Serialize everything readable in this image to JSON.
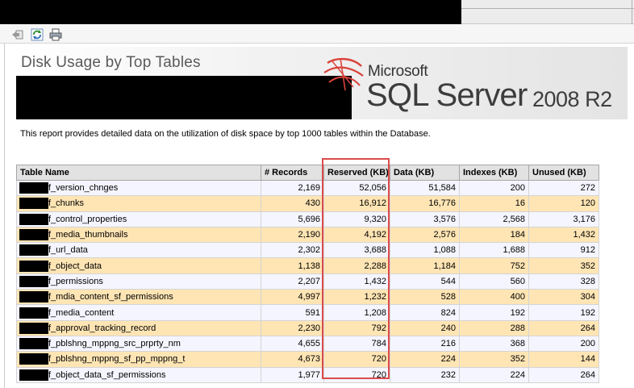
{
  "toolbar": {
    "icons": [
      "back-icon",
      "refresh-icon",
      "print-icon"
    ]
  },
  "header": {
    "report_title": "Disk Usage by Top Tables",
    "logo": {
      "brand": "Microsoft",
      "product": "SQL Server",
      "version": "2008 R2"
    }
  },
  "description": "This report provides detailed data on the utilization of disk space by top 1000 tables within the Database.",
  "table": {
    "headers": [
      "Table Name",
      "# Records",
      "Reserved (KB)",
      "Data (KB)",
      "Indexes (KB)",
      "Unused (KB)"
    ],
    "rows": [
      {
        "name": "f_version_chnges",
        "records": "2,169",
        "reserved": "52,056",
        "data": "51,584",
        "indexes": "200",
        "unused": "272"
      },
      {
        "name": "f_chunks",
        "records": "430",
        "reserved": "16,912",
        "data": "16,776",
        "indexes": "16",
        "unused": "120"
      },
      {
        "name": "f_control_properties",
        "records": "5,696",
        "reserved": "9,320",
        "data": "3,576",
        "indexes": "2,568",
        "unused": "3,176"
      },
      {
        "name": "f_media_thumbnails",
        "records": "2,190",
        "reserved": "4,192",
        "data": "2,576",
        "indexes": "184",
        "unused": "1,432"
      },
      {
        "name": "f_url_data",
        "records": "2,302",
        "reserved": "3,688",
        "data": "1,088",
        "indexes": "1,688",
        "unused": "912"
      },
      {
        "name": "f_object_data",
        "records": "1,138",
        "reserved": "2,288",
        "data": "1,184",
        "indexes": "752",
        "unused": "352"
      },
      {
        "name": "f_permissions",
        "records": "2,207",
        "reserved": "1,432",
        "data": "544",
        "indexes": "560",
        "unused": "328"
      },
      {
        "name": "f_mdia_content_sf_permissions",
        "records": "4,997",
        "reserved": "1,232",
        "data": "528",
        "indexes": "400",
        "unused": "304"
      },
      {
        "name": "f_media_content",
        "records": "591",
        "reserved": "1,208",
        "data": "824",
        "indexes": "192",
        "unused": "192"
      },
      {
        "name": "f_approval_tracking_record",
        "records": "2,230",
        "reserved": "792",
        "data": "240",
        "indexes": "288",
        "unused": "264"
      },
      {
        "name": "f_pblshng_mppng_src_prprty_nm",
        "records": "4,655",
        "reserved": "784",
        "data": "216",
        "indexes": "368",
        "unused": "200"
      },
      {
        "name": "f_pblshng_mppng_sf_pp_mppng_t",
        "records": "4,673",
        "reserved": "720",
        "data": "224",
        "indexes": "352",
        "unused": "144"
      },
      {
        "name": "f_object_data_sf_permissions",
        "records": "1,977",
        "reserved": "720",
        "data": "232",
        "indexes": "224",
        "unused": "264"
      }
    ]
  }
}
